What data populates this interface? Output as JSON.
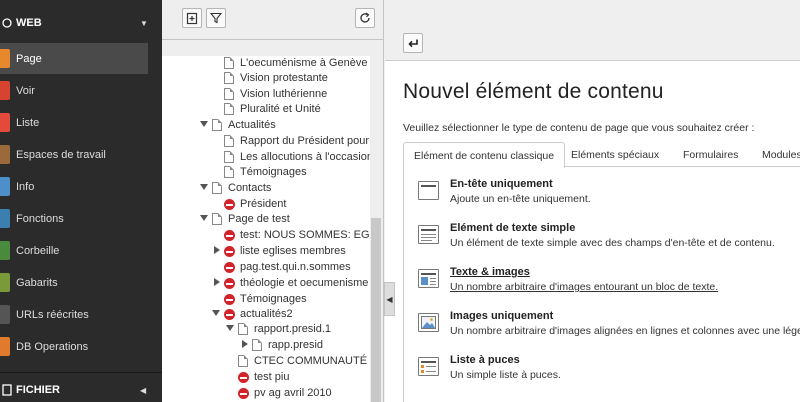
{
  "menu": {
    "sections": [
      {
        "label": "WEB"
      },
      {
        "label": "FICHIER"
      }
    ],
    "modules": [
      {
        "label": "Page",
        "color": "#e8882c",
        "active": true
      },
      {
        "label": "Voir",
        "color": "#d64331"
      },
      {
        "label": "Liste",
        "color": "#e44a3b"
      },
      {
        "label": "Espaces de travail",
        "color": "#9a6a3a"
      },
      {
        "label": "Info",
        "color": "#4d8fc8"
      },
      {
        "label": "Fonctions",
        "color": "#3a7fb0"
      },
      {
        "label": "Corbeille",
        "color": "#4a8a3c"
      },
      {
        "label": "Gabarits",
        "color": "#7a9a3a"
      },
      {
        "label": "URLs réécrites",
        "color": "#555555"
      },
      {
        "label": "DB Operations",
        "color": "#e07a2c"
      }
    ]
  },
  "tree": {
    "rows": [
      {
        "label": "L'oecuménisme à  Genève a",
        "icon": "page"
      },
      {
        "label": "Vision protestante",
        "icon": "page"
      },
      {
        "label": "Vision luthérienne",
        "icon": "page"
      },
      {
        "label": "Pluralité et Unité",
        "icon": "page"
      },
      {
        "label": "Actualités",
        "icon": "page"
      },
      {
        "label": "Rapport du Président pour l",
        "icon": "page"
      },
      {
        "label": "Les allocutions à  l'occasion",
        "icon": "page"
      },
      {
        "label": "Témoignages",
        "icon": "page"
      },
      {
        "label": "Contacts",
        "icon": "page"
      },
      {
        "label": "Président",
        "icon": "hidden"
      },
      {
        "label": "Page de test",
        "icon": "page"
      },
      {
        "label": "test: NOUS SOMMES: EGLI",
        "icon": "hidden"
      },
      {
        "label": "liste eglises membres",
        "icon": "hidden"
      },
      {
        "label": "pag.test.qui.n.sommes",
        "icon": "hidden"
      },
      {
        "label": "théologie et oecumenisme",
        "icon": "hidden"
      },
      {
        "label": "Témoignages",
        "icon": "hidden"
      },
      {
        "label": "actualités2",
        "icon": "hidden"
      },
      {
        "label": "rapport.presid.1",
        "icon": "page"
      },
      {
        "label": "rapp.presid",
        "icon": "page"
      },
      {
        "label": "CTEC COMMUNAUTÉ DE",
        "icon": "page"
      },
      {
        "label": "test piu",
        "icon": "hidden"
      },
      {
        "label": "pv ag avril 2010",
        "icon": "hidden"
      }
    ]
  },
  "content": {
    "title": "Nouvel élément de contenu",
    "intro": "Veuillez sélectionner le type de contenu de page que vous souhaitez créer :",
    "tabs": [
      "Elément de contenu classique",
      "Eléments spéciaux",
      "Formulaires",
      "Modules"
    ],
    "types": [
      {
        "title": "En-tête uniquement",
        "desc": "Ajoute un en-tête uniquement."
      },
      {
        "title": "Elément de texte simple",
        "desc": "Un élément de texte simple avec des champs d'en-tête et de contenu."
      },
      {
        "title": "Texte & images",
        "desc": "Un nombre arbitraire d'images entourant un bloc de texte."
      },
      {
        "title": "Images uniquement",
        "desc": "Un nombre arbitraire d'images alignées en lignes et colonnes avec une légende"
      },
      {
        "title": "Liste à puces",
        "desc": "Un simple liste à puces."
      }
    ]
  }
}
